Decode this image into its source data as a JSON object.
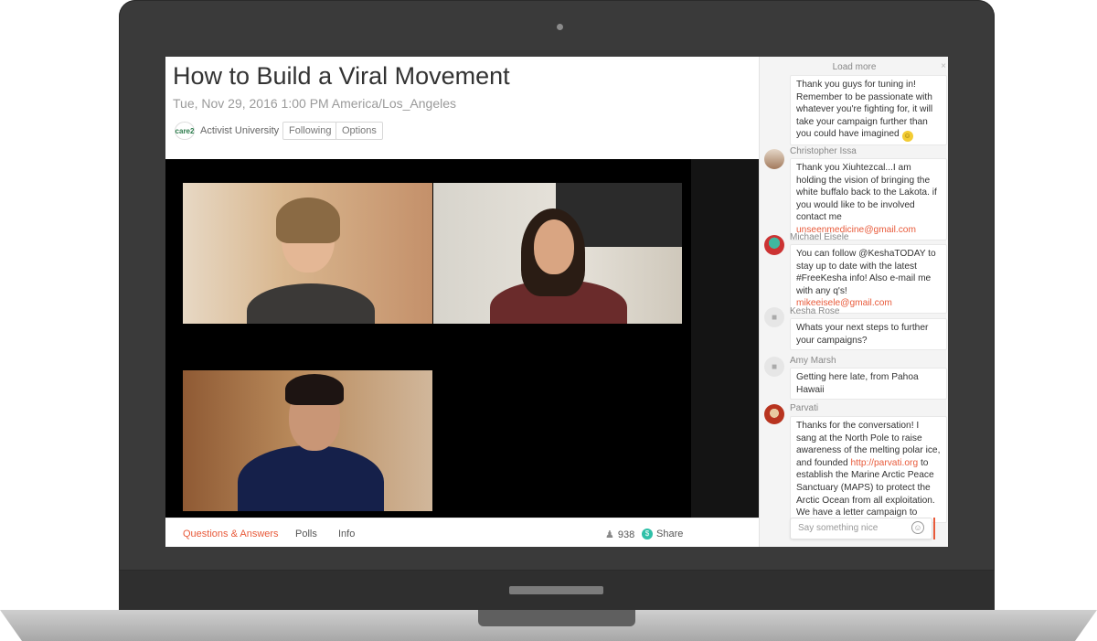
{
  "event": {
    "title": "How to Build a Viral Movement",
    "datetime": "Tue, Nov 29, 2016 1:00 PM America/Los_Angeles",
    "organizer_logo": "care2",
    "organizer": "Activist University",
    "following_label": "Following",
    "options_label": "Options"
  },
  "tabs": {
    "qa": "Questions & Answers",
    "polls": "Polls",
    "info": "Info",
    "viewers": "938",
    "share": "Share"
  },
  "chat": {
    "load_more": "Load more",
    "input_placeholder": "Say something nice",
    "first_message": {
      "text": "Thank you guys for tuning in! Remember to be passionate with whatever you're fighting for, it will take your campaign further than you could have imagined"
    },
    "messages": [
      {
        "author": "Christopher Issa",
        "text": "Thank you Xiuhtezcal...I am holding the vision of bringing the white buffalo back to the Lakota. if you would like to be involved contact me",
        "link": "unseenmedicine@gmail.com"
      },
      {
        "author": "Michael Eisele",
        "text": "You can follow @KeshaTODAY to stay up to date with the latest #FreeKesha info! Also e-mail me with any q's!",
        "link": "mikeeisele@gmail.com"
      },
      {
        "author": "Kesha Rose",
        "text": "Whats your next steps to further your campaigns?"
      },
      {
        "author": "Amy Marsh",
        "text": "Getting here late, from Pahoa Hawaii"
      },
      {
        "author": "Parvati",
        "text_before": "Thanks for the conversation! I sang at the North Pole to raise awareness of the melting polar ice, and founded",
        "link": "http://parvati.org",
        "text_after": "to establish the Marine Arctic Peace Sanctuary (MAPS) to protect the Arctic Ocean from all exploitation. We have a letter campaign to"
      }
    ]
  },
  "colors": {
    "accent": "#e85a3a",
    "share": "#2fc0a8",
    "laptop": "#3a3a3a"
  }
}
